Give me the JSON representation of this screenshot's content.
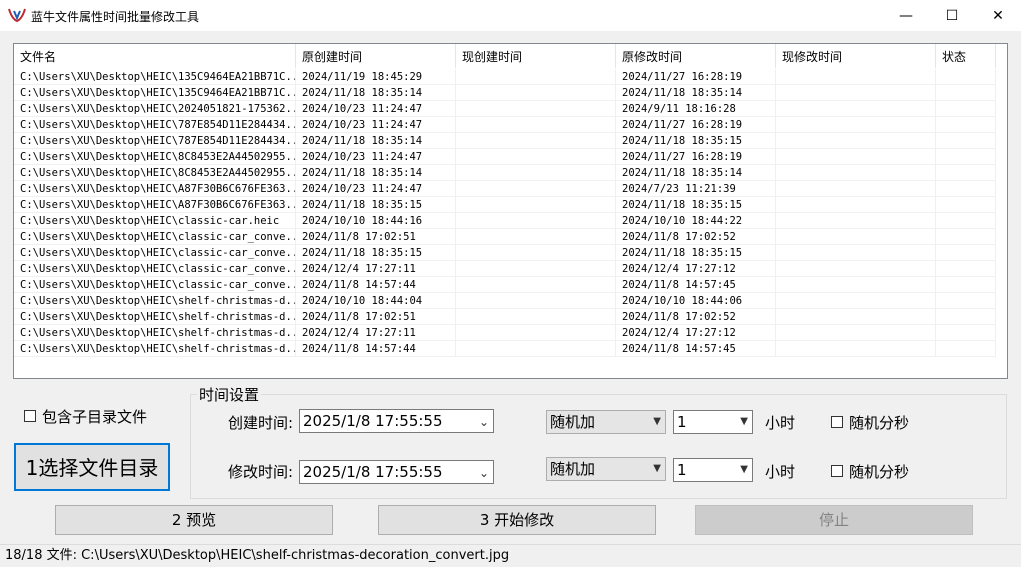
{
  "window": {
    "title": "蓝牛文件属性时间批量修改工具",
    "minimize": "—",
    "maximize": "☐",
    "close": "✕"
  },
  "table": {
    "columns": [
      "文件名",
      "原创建时间",
      "现创建时间",
      "原修改时间",
      "现修改时间",
      "状态"
    ],
    "rows": [
      [
        "C:\\Users\\XU\\Desktop\\HEIC\\135C9464EA21BB71C...",
        "2024/11/19 18:45:29",
        "",
        "2024/11/27 16:28:19",
        "",
        ""
      ],
      [
        "C:\\Users\\XU\\Desktop\\HEIC\\135C9464EA21BB71C...",
        "2024/11/18 18:35:14",
        "",
        "2024/11/18 18:35:14",
        "",
        ""
      ],
      [
        "C:\\Users\\XU\\Desktop\\HEIC\\2024051821-175362...",
        "2024/10/23 11:24:47",
        "",
        "2024/9/11 18:16:28",
        "",
        ""
      ],
      [
        "C:\\Users\\XU\\Desktop\\HEIC\\787E854D11E284434...",
        "2024/10/23 11:24:47",
        "",
        "2024/11/27 16:28:19",
        "",
        ""
      ],
      [
        "C:\\Users\\XU\\Desktop\\HEIC\\787E854D11E284434...",
        "2024/11/18 18:35:14",
        "",
        "2024/11/18 18:35:15",
        "",
        ""
      ],
      [
        "C:\\Users\\XU\\Desktop\\HEIC\\8C8453E2A44502955...",
        "2024/10/23 11:24:47",
        "",
        "2024/11/27 16:28:19",
        "",
        ""
      ],
      [
        "C:\\Users\\XU\\Desktop\\HEIC\\8C8453E2A44502955...",
        "2024/11/18 18:35:14",
        "",
        "2024/11/18 18:35:14",
        "",
        ""
      ],
      [
        "C:\\Users\\XU\\Desktop\\HEIC\\A87F30B6C676FE363...",
        "2024/10/23 11:24:47",
        "",
        "2024/7/23 11:21:39",
        "",
        ""
      ],
      [
        "C:\\Users\\XU\\Desktop\\HEIC\\A87F30B6C676FE363...",
        "2024/11/18 18:35:15",
        "",
        "2024/11/18 18:35:15",
        "",
        ""
      ],
      [
        "C:\\Users\\XU\\Desktop\\HEIC\\classic-car.heic",
        "2024/10/10 18:44:16",
        "",
        "2024/10/10 18:44:22",
        "",
        ""
      ],
      [
        "C:\\Users\\XU\\Desktop\\HEIC\\classic-car_conve...",
        "2024/11/8 17:02:51",
        "",
        "2024/11/8 17:02:52",
        "",
        ""
      ],
      [
        "C:\\Users\\XU\\Desktop\\HEIC\\classic-car_conve...",
        "2024/11/18 18:35:15",
        "",
        "2024/11/18 18:35:15",
        "",
        ""
      ],
      [
        "C:\\Users\\XU\\Desktop\\HEIC\\classic-car_conve...",
        "2024/12/4 17:27:11",
        "",
        "2024/12/4 17:27:12",
        "",
        ""
      ],
      [
        "C:\\Users\\XU\\Desktop\\HEIC\\classic-car_conve...",
        "2024/11/8 14:57:44",
        "",
        "2024/11/8 14:57:45",
        "",
        ""
      ],
      [
        "C:\\Users\\XU\\Desktop\\HEIC\\shelf-christmas-d...",
        "2024/10/10 18:44:04",
        "",
        "2024/10/10 18:44:06",
        "",
        ""
      ],
      [
        "C:\\Users\\XU\\Desktop\\HEIC\\shelf-christmas-d...",
        "2024/11/8 17:02:51",
        "",
        "2024/11/8 17:02:52",
        "",
        ""
      ],
      [
        "C:\\Users\\XU\\Desktop\\HEIC\\shelf-christmas-d...",
        "2024/12/4 17:27:11",
        "",
        "2024/12/4 17:27:12",
        "",
        ""
      ],
      [
        "C:\\Users\\XU\\Desktop\\HEIC\\shelf-christmas-d...",
        "2024/11/8 14:57:44",
        "",
        "2024/11/8 14:57:45",
        "",
        ""
      ]
    ]
  },
  "options": {
    "include_subdirs": "包含子目录文件",
    "include_subdirs_checked": false,
    "select_dir_button": "1选择文件目录"
  },
  "time_settings": {
    "title": "时间设置",
    "create": {
      "label": "创建时间:",
      "value": "2025/1/8 17:55:55",
      "mode": "随机加",
      "amount": "1",
      "unit": "小时",
      "random_label": "随机分秒",
      "random_checked": false
    },
    "modify": {
      "label": "修改时间:",
      "value": "2025/1/8 17:55:55",
      "mode": "随机加",
      "amount": "1",
      "unit": "小时",
      "random_label": "随机分秒",
      "random_checked": false
    }
  },
  "buttons": {
    "preview": "2 预览",
    "start": "3 开始修改",
    "stop": "停止"
  },
  "status": "18/18 文件: C:\\Users\\XU\\Desktop\\HEIC\\shelf-christmas-decoration_convert.jpg"
}
